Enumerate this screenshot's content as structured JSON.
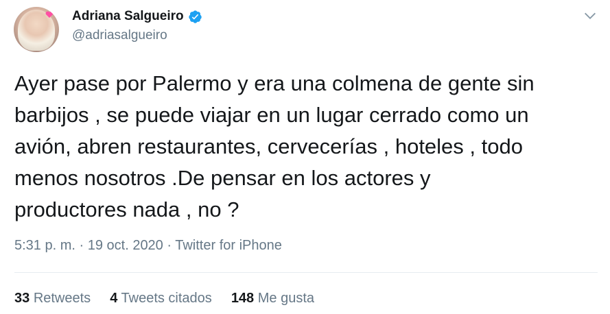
{
  "author": {
    "display_name": "Adriana Salgueiro",
    "handle": "@adriasalgueiro",
    "verified": true
  },
  "tweet": {
    "text": "Ayer pase por Palermo y era una colmena de gente sin\nbarbijos , se puede viajar en un lugar cerrado como un\navión, abren restaurantes, cervecerías , hoteles , todo\nmenos nosotros .De pensar en los actores y\nproductores nada , no ?",
    "time": "5:31 p. m.",
    "date": "19 oct. 2020",
    "source": "Twitter for iPhone",
    "separator": " · "
  },
  "stats": {
    "retweets_count": "33",
    "retweets_label": "Retweets",
    "quotes_count": "4",
    "quotes_label": "Tweets citados",
    "likes_count": "148",
    "likes_label": "Me gusta"
  },
  "colors": {
    "accent": "#1da1f2",
    "text": "#14171a",
    "muted": "#657786"
  },
  "icons": {
    "verified": "verified-badge-icon",
    "caret": "chevron-down-icon"
  }
}
